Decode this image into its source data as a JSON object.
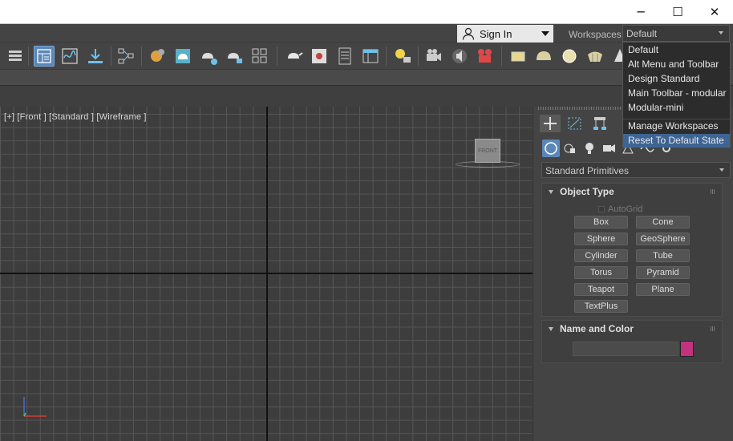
{
  "window": {
    "minimize_glyph": "─",
    "maximize_glyph": "☐",
    "close_glyph": "✕"
  },
  "signin": {
    "label": "Sign In",
    "icon": "person-icon"
  },
  "workspaces": {
    "label": "Workspaces:",
    "selected": "Default",
    "options": [
      "Default",
      "Alt Menu and Toolbar",
      "Design Standard",
      "Main Toolbar - modular",
      "Modular-mini"
    ],
    "actions": [
      "Manage Workspaces",
      "Reset To Default State"
    ],
    "highlighted": "Reset To Default State",
    "highlight_color": "#3e6494"
  },
  "viewport": {
    "label": "[+] [Front ] [Standard ] [Wireframe ]",
    "viewcube_label": "FRONT"
  },
  "command_panel": {
    "category": "Standard Primitives",
    "object_type": {
      "title": "Object Type",
      "autogrid": "AutoGrid",
      "buttons": [
        "Box",
        "Cone",
        "Sphere",
        "GeoSphere",
        "Cylinder",
        "Tube",
        "Torus",
        "Pyramid",
        "Teapot",
        "Plane",
        "TextPlus"
      ]
    },
    "name_and_color": {
      "title": "Name and Color",
      "name_value": "",
      "color": "#c4317e"
    }
  },
  "colors": {
    "accent": "#5b87b8",
    "background": "#444444"
  }
}
